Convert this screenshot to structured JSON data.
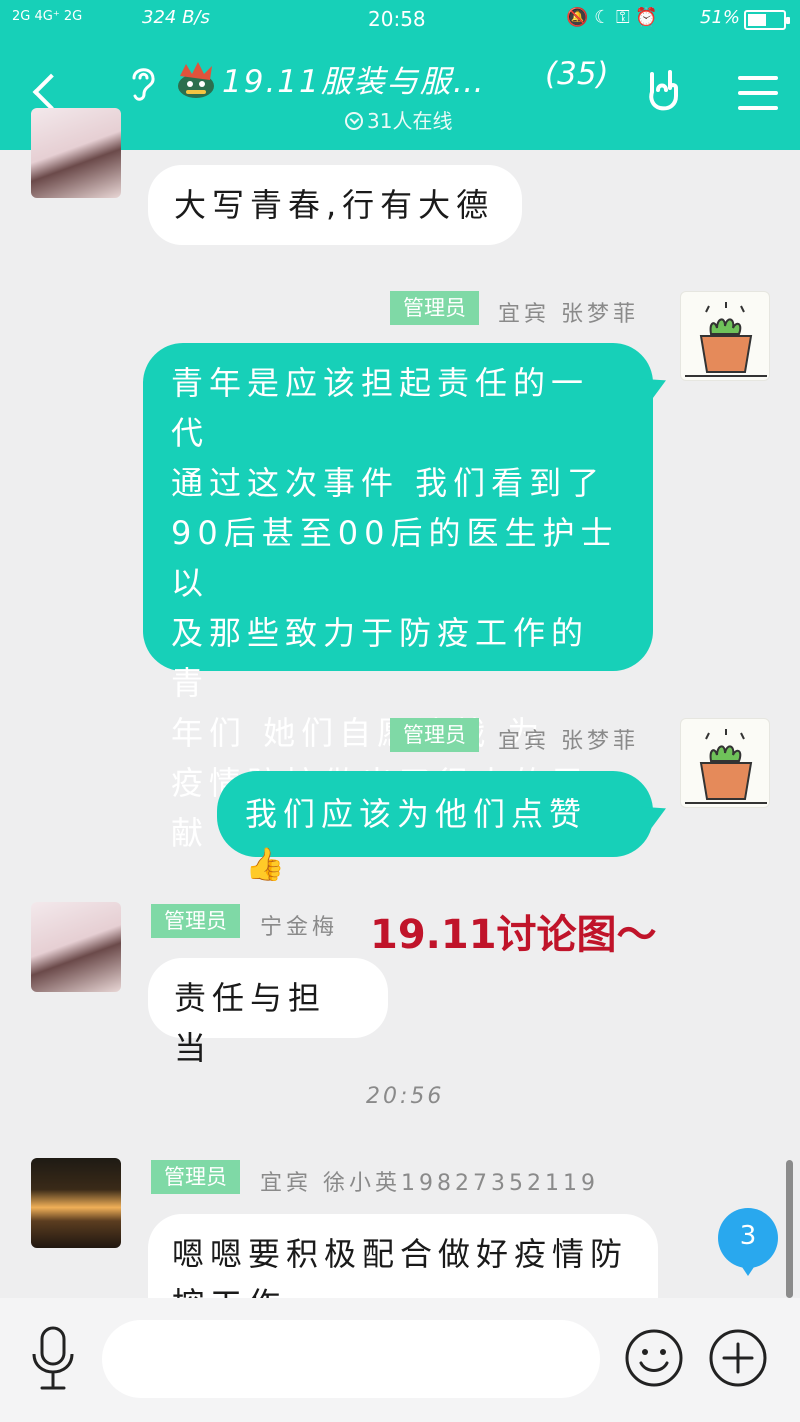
{
  "status_bar": {
    "signal": "2G 4G⁺ 2G",
    "speed": "324 B/s",
    "time": "20:58",
    "icons": "🔕 ☾ ⚿ ⏰",
    "battery": "51%"
  },
  "header": {
    "title": "19.11服装与服…",
    "member_count": "(35)",
    "online": "31人在线"
  },
  "messages": [
    {
      "text": "大写青春,行有大德"
    },
    {
      "badge": "管理员",
      "nick": "宜宾  张梦菲",
      "lines": [
        "青年是应该担起责任的一代",
        "通过这次事件 我们看到了",
        "90后甚至00后的医生护士以",
        "及那些致力于防疫工作的青",
        "年们  她们自愿请战    为",
        "疫情防控做出了很大的贡献"
      ]
    },
    {
      "badge": "管理员",
      "nick": "宜宾  张梦菲",
      "text": "我们应该为他们点赞👍"
    },
    {
      "badge": "管理员",
      "nick": "宁金梅",
      "text": "责任与担当"
    },
    {
      "badge": "管理员",
      "nick": "宜宾  徐小英19827352119",
      "text": "嗯嗯要积极配合做好疫情防",
      "text2": "控工作"
    }
  ],
  "watermark": "19.11讨论图～",
  "timestamp": "20:56",
  "unread_count": "3",
  "icons": {
    "back": "chevron-left-icon",
    "ear": "ear-icon",
    "rock": "rock-hand-icon",
    "menu": "menu-icon",
    "mic": "microphone-icon",
    "emoji": "smiley-icon",
    "plus": "plus-icon"
  },
  "colors": {
    "accent": "#17d0b8",
    "badge": "#7fd9a6",
    "unread": "#29a8ee",
    "watermark": "#c0142a"
  }
}
